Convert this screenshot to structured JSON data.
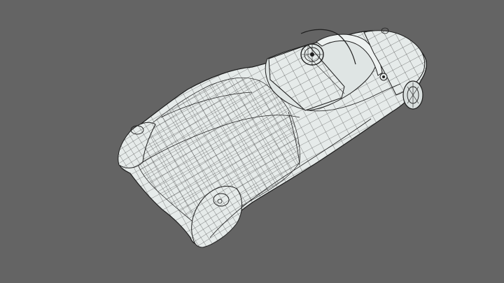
{
  "viewport": {
    "background_color": "#646464"
  },
  "model": {
    "subject": "convertible-car-wireframe",
    "surface_color": "#e6ebea",
    "wire_color": "#1e1e1e"
  }
}
